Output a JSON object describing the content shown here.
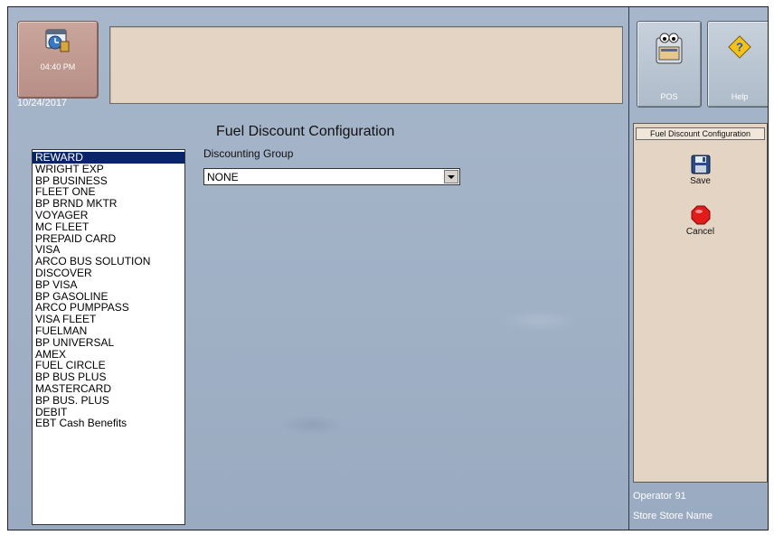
{
  "header": {
    "clock_time": "04:40 PM",
    "date": "10/24/2017",
    "message": ""
  },
  "page": {
    "title": "Fuel Discount Configuration",
    "discount_group_label": "Discounting Group",
    "discount_group_value": "NONE"
  },
  "card_list": {
    "selected_index": 0,
    "items": [
      "REWARD",
      "WRIGHT EXP",
      "BP BUSINESS",
      "FLEET ONE",
      "BP BRND MKTR",
      "VOYAGER",
      "MC FLEET",
      "PREPAID CARD",
      "VISA",
      "ARCO BUS SOLUTION",
      "DISCOVER",
      "BP VISA",
      "BP GASOLINE",
      "ARCO PUMPPASS",
      "VISA FLEET",
      "FUELMAN",
      "BP UNIVERSAL",
      "AMEX",
      "FUEL CIRCLE",
      "BP BUS PLUS",
      "MASTERCARD",
      "BP BUS. PLUS",
      "DEBIT",
      "EBT Cash Benefits"
    ]
  },
  "right_panel": {
    "pos_label": "POS",
    "help_label": "Help",
    "panel_header": "Fuel Discount Configuration",
    "save_label": "Save",
    "cancel_label": "Cancel",
    "operator": "Operator 91",
    "store": "Store Store Name"
  },
  "icons": {
    "clock": "clock-icon",
    "pos": "pos-terminal-icon",
    "help": "help-icon",
    "save": "save-disk-icon",
    "cancel": "cancel-stop-icon"
  },
  "colors": {
    "selection": "#0a2468",
    "background": "#9fb0c6",
    "panel": "#e3d4c3"
  }
}
